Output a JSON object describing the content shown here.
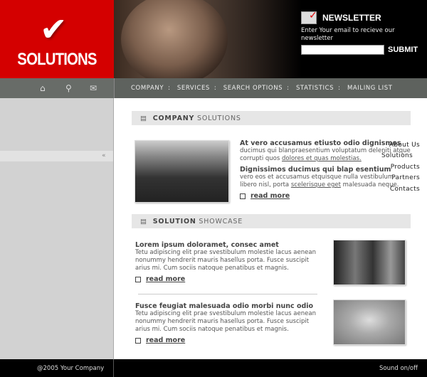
{
  "brand": {
    "name": "SOLUTIONS",
    "color": "#d40000"
  },
  "newsletter": {
    "title": "NEWSLETTER",
    "text": "Enter Your email to recieve our newsletter",
    "input_value": "",
    "submit": "SUBMIT"
  },
  "icons": [
    "home-icon",
    "search-icon",
    "mail-icon"
  ],
  "topnav": [
    "COMPANY",
    "SERVICES",
    "SEARCH OPTIONS",
    "STATISTICS",
    "MAILING LIST"
  ],
  "sidebar": {
    "items": [
      "About Us",
      "Solutions",
      "Products",
      "Partners",
      "Contacts"
    ],
    "active": "Solutions",
    "active_marker": "«"
  },
  "company": {
    "title_bold": "COMPANY",
    "title_rest": "SOLUTIONS",
    "h1": "At vero accusamus etiusto odio dignismos",
    "p1": "ducimus qui blanpraesentium voluptatum deleniti atque corrupti quos ",
    "link1": "dolores et quas molestias.",
    "h2": "Dignissimos ducimus qui blap esentium",
    "p2": "vero eos et accusamus etquisque nulla vestibulum libero nisl, porta ",
    "link2": "scelerisque eget",
    "p2b": " malesuada  neque.",
    "read_more": "read more"
  },
  "showcase": {
    "title_bold": "SOLUTION",
    "title_rest": "SHOWCASE",
    "items": [
      {
        "title": "Lorem ipsum doloramet, consec amet",
        "text": "Tetu adipiscing elit prae svestibulum molestie lacus aenean nonummy hendrerit mauris hasellus porta. Fusce suscipit arius mi. Cum sociis natoque penatibus et magnis.",
        "read_more": "read more"
      },
      {
        "title": "Fusce feugiat malesuada odio morbi nunc odio",
        "text": "Tetu adipiscing elit prae svestibulum molestie lacus aenean nonummy hendrerit mauris hasellus porta. Fusce suscipit arius mi. Cum sociis natoque penatibus et magnis.",
        "read_more": "read more"
      }
    ]
  },
  "footer": {
    "copyright": "@2005 Your Company",
    "sound": "Sound on/off"
  }
}
